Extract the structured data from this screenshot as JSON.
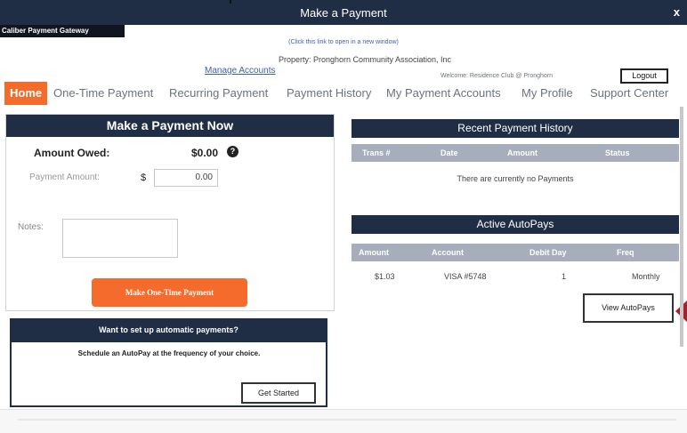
{
  "window": {
    "title": "Make a Payment",
    "close_label": "x"
  },
  "gateway": {
    "title": "Caliber Payment Gateway"
  },
  "header": {
    "open_link": "(Click this link to open in a new window)",
    "property": "Property: Pronghorn Community Association, Inc",
    "manage_accounts": "Manage Accounts",
    "welcome": "Welcome: Residence Club @ Pronghorn",
    "logout": "Logout"
  },
  "nav": {
    "tabs": [
      {
        "label": "Home",
        "active": true
      },
      {
        "label": "One-Time Payment"
      },
      {
        "label": "Recurring Payment"
      },
      {
        "label": "Payment History"
      },
      {
        "label": "My Payment Accounts"
      },
      {
        "label": "My Profile"
      },
      {
        "label": "Support Center"
      }
    ]
  },
  "make_payment": {
    "title": "Make a Payment Now",
    "amount_owed_label": "Amount Owed:",
    "amount_owed_value": "$0.00",
    "help_icon": "question-circle-icon",
    "payment_amount_label": "Payment Amount:",
    "currency_symbol": "$",
    "payment_amount_value": "0.00",
    "notes_label": "Notes:",
    "notes_value": "",
    "submit_label": "Make One-Time Payment"
  },
  "autopay_promo": {
    "title": "Want to set up automatic payments?",
    "body": "Schedule an AutoPay at the frequency of your choice.",
    "button": "Get Started"
  },
  "recent_history": {
    "title": "Recent Payment History",
    "columns": [
      "Trans #",
      "Date",
      "Amount",
      "Status"
    ],
    "empty_message": "There are currently no Payments"
  },
  "active_autopays": {
    "title": "Active AutoPays",
    "columns": [
      "Amount",
      "Account",
      "Debit Day",
      "Freq"
    ],
    "rows": [
      {
        "amount": "$1.03",
        "account": "VISA #5748",
        "debit_day": "1",
        "freq": "Monthly"
      }
    ],
    "view_button": "View AutoPays"
  },
  "colors": {
    "navy": "#1f2d45",
    "accent_orange": "#f46b2b",
    "column_gray": "#a7aebb",
    "link_blue": "#3b5fb0",
    "marker_red": "#a8202e"
  }
}
